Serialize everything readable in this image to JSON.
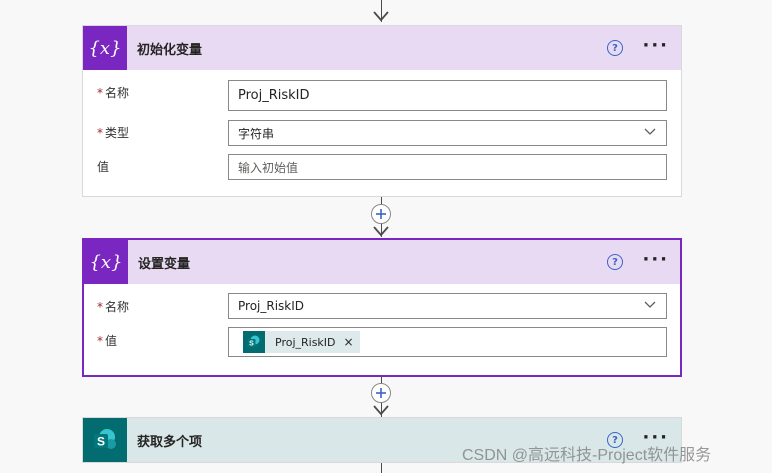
{
  "initialize_card": {
    "title": "初始化变量",
    "icon": "variable-icon",
    "name_label": "名称",
    "name_value": "Proj_RiskID",
    "type_label": "类型",
    "type_value": "字符串",
    "value_label": "值",
    "value_placeholder": "输入初始值"
  },
  "set_card": {
    "title": "设置变量",
    "icon": "variable-icon",
    "name_label": "名称",
    "name_value": "Proj_RiskID",
    "value_label": "值",
    "token_text": "Proj_RiskID",
    "token_close": "×"
  },
  "sharepoint_card": {
    "title": "获取多个项",
    "icon": "sharepoint-icon"
  },
  "common": {
    "help_glyph": "?",
    "more_glyph": "···",
    "required_mark": "*",
    "var_glyph": "{x}"
  },
  "watermark": "CSDN @高远科技-Project软件服务",
  "colors": {
    "variable_accent": "#7a26c1",
    "variable_header": "#e8daf3",
    "sharepoint_accent": "#036c70",
    "sharepoint_header": "#d9e7e8"
  }
}
